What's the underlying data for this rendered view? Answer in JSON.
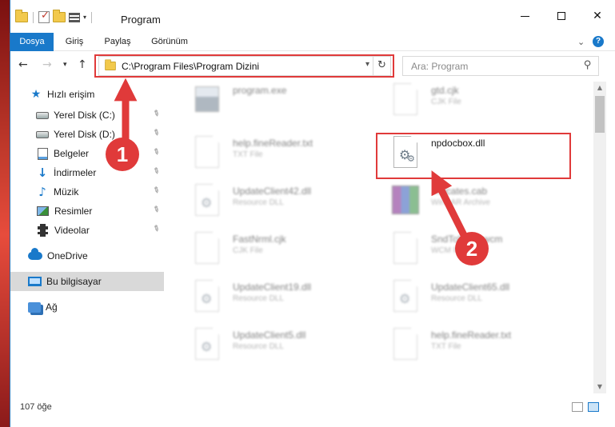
{
  "window": {
    "title": "Program",
    "qat_dropdown": "▾",
    "minimize_label": "",
    "maximize_label": "",
    "close_label": "✕"
  },
  "ribbon": {
    "tabs": [
      {
        "label": "Dosya",
        "active": true
      },
      {
        "label": "Giriş",
        "active": false
      },
      {
        "label": "Paylaş",
        "active": false
      },
      {
        "label": "Görünüm",
        "active": false
      }
    ],
    "expand_icon": "chevron-down-icon",
    "help_label": "?"
  },
  "navigation": {
    "back": "←",
    "forward": "→",
    "recent": "▾",
    "up": "↑",
    "address": "C:\\Program Files\\Program Dizini",
    "address_dropdown": "▾",
    "refresh": "↻",
    "search_placeholder": "Ara: Program",
    "search_icon": "⚲"
  },
  "sidebar": {
    "items": [
      {
        "label": "Hızlı erişim",
        "icon": "star-icon"
      },
      {
        "label": "Yerel Disk (C:)",
        "icon": "disk-icon",
        "pinned": true
      },
      {
        "label": "Yerel Disk (D:)",
        "icon": "disk-icon",
        "pinned": true
      },
      {
        "label": "Belgeler",
        "icon": "document-icon",
        "pinned": true
      },
      {
        "label": "İndirmeler",
        "icon": "download-icon",
        "pinned": true
      },
      {
        "label": "Müzik",
        "icon": "music-icon",
        "pinned": true
      },
      {
        "label": "Resimler",
        "icon": "picture-icon",
        "pinned": true
      },
      {
        "label": "Videolar",
        "icon": "video-icon",
        "pinned": true
      },
      {
        "label": "OneDrive",
        "icon": "cloud-icon"
      },
      {
        "label": "Bu bilgisayar",
        "icon": "computer-icon",
        "selected": true
      },
      {
        "label": "Ağ",
        "icon": "network-icon"
      }
    ],
    "pin_glyph": "📌"
  },
  "files": [
    {
      "name": "program.exe",
      "type": "",
      "icon": "exe-icon",
      "blurred": true
    },
    {
      "name": "gtd.cjk",
      "type": "CJK File",
      "icon": "page-icon",
      "blurred": true
    },
    {
      "name": "help.fineReader.txt",
      "type": "TXT File",
      "icon": "page-icon",
      "blurred": true
    },
    {
      "name": "npdocbox.dll",
      "type": "",
      "icon": "dll-gear-icon",
      "blurred": false,
      "highlighted": true
    },
    {
      "name": "UpdateClient42.dll",
      "type": "Resource DLL",
      "icon": "dll-gear-icon",
      "blurred": true
    },
    {
      "name": "...ificates.cab",
      "type": "WinRAR Archive",
      "icon": "winrar-icon",
      "blurred": true
    },
    {
      "name": "FastNrml.cjk",
      "type": "CJK File",
      "icon": "page-icon",
      "blurred": true
    },
    {
      "name": "SndToWcm.wcm",
      "type": "WCM File",
      "icon": "page-icon",
      "blurred": true
    },
    {
      "name": "UpdateClient19.dll",
      "type": "Resource DLL",
      "icon": "dll-gear-icon",
      "blurred": true
    },
    {
      "name": "UpdateClient65.dll",
      "type": "Resource DLL",
      "icon": "dll-gear-icon",
      "blurred": true
    },
    {
      "name": "UpdateClient5.dll",
      "type": "Resource DLL",
      "icon": "dll-gear-icon",
      "blurred": true
    },
    {
      "name": "help.fineReader.txt",
      "type": "TXT File",
      "icon": "page-icon",
      "blurred": true
    }
  ],
  "status": {
    "item_count": "107 öğe"
  },
  "annotations": [
    {
      "label": "1",
      "color": "#e03a3a"
    },
    {
      "label": "2",
      "color": "#e03a3a"
    }
  ],
  "colors": {
    "accent": "#1979ca",
    "highlight": "#e03a3a"
  }
}
